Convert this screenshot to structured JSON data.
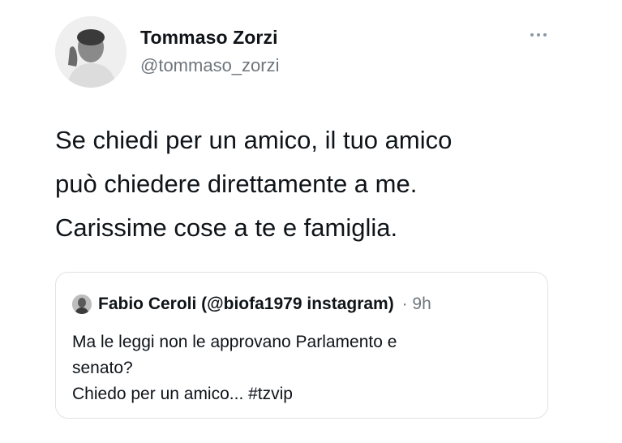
{
  "author": {
    "name": "Tommaso Zorzi",
    "handle": "@tommaso_zorzi"
  },
  "tweet": {
    "lines": [
      "Se chiedi per un amico, il tuo amico",
      "può chiedere direttamente a me.",
      "Carissime cose a te e famiglia."
    ]
  },
  "quote": {
    "name": "Fabio Ceroli (@biofa1979 instagram)",
    "separator": "·",
    "time": "9h",
    "lines": [
      "Ma le leggi non le approvano Parlamento e",
      "senato?",
      "Chiedo per un amico... #tzvip"
    ]
  },
  "icons": {
    "more": "more-horizontal-icon"
  },
  "colors": {
    "text": "#0f1419",
    "secondary": "#6e767d",
    "border": "#dfe3e6"
  }
}
